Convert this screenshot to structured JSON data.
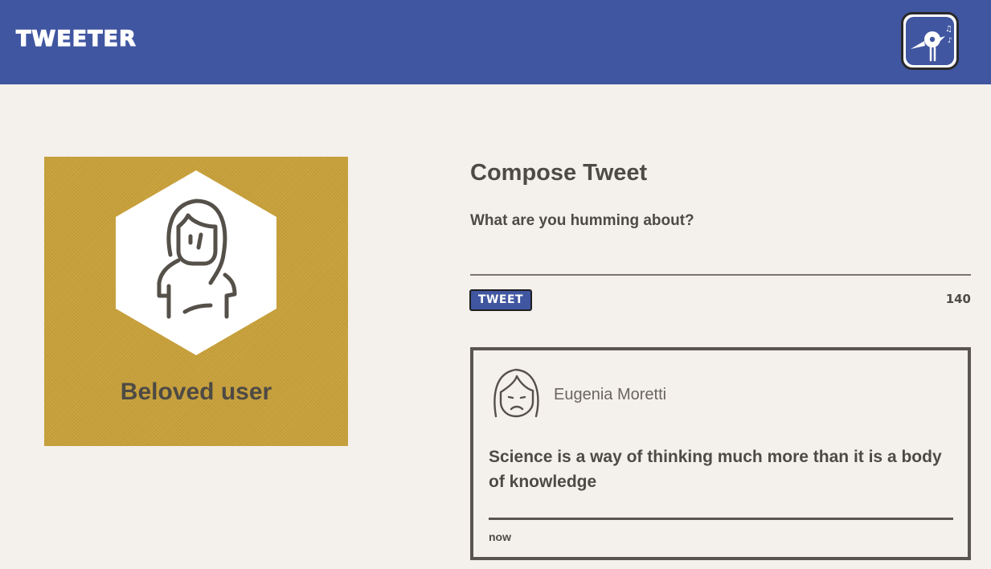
{
  "header": {
    "brand": "Tweeter",
    "logo_icon": "bird-singing-icon",
    "background": "#4056a1"
  },
  "profile": {
    "name": "Beloved user",
    "avatar_icon": "woman-avatar-icon",
    "background": "#c9a13a"
  },
  "compose": {
    "title": "Compose Tweet",
    "placeholder": "What are you humming about?",
    "button_label": "TWEET",
    "counter": "140"
  },
  "tweets": [
    {
      "author": "Eugenia Moretti",
      "avatar_icon": "sad-woman-avatar-icon",
      "text": "Science is a way of thinking much more than it is a body of knowledge",
      "time": "now"
    }
  ]
}
